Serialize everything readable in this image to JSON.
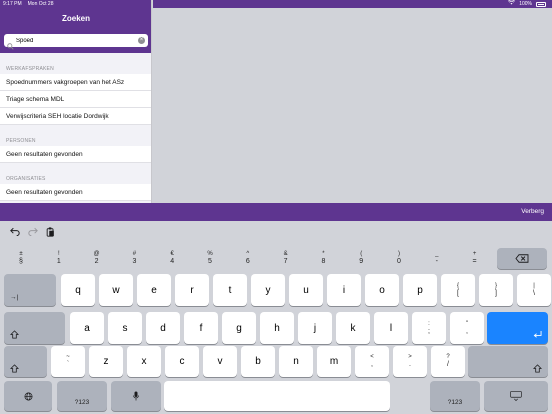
{
  "status": {
    "time": "9:17 PM",
    "date": "Mon Oct 28",
    "battery": "100%"
  },
  "sidebar": {
    "title": "Zoeken",
    "search": {
      "value": "Spoed",
      "placeholder": "Zoeken"
    },
    "sections": [
      {
        "header": "WERKAFSPRAKEN",
        "rows": [
          "Spoednummers vakgroepen van het ASz",
          "Triage schema MDL",
          "Verwijscriteria SEH locatie Dordwijk"
        ]
      },
      {
        "header": "PERSONEN",
        "rows": [
          "Geen resultaten gevonden"
        ]
      },
      {
        "header": "ORGANISATIES",
        "rows": [
          "Geen resultaten gevonden"
        ]
      }
    ]
  },
  "accessory": {
    "hide_label": "Verberg"
  },
  "keyboard": {
    "number_row": [
      {
        "top": "±",
        "bot": "§"
      },
      {
        "top": "!",
        "bot": "1"
      },
      {
        "top": "@",
        "bot": "2"
      },
      {
        "top": "#",
        "bot": "3"
      },
      {
        "top": "€",
        "bot": "4"
      },
      {
        "top": "%",
        "bot": "5"
      },
      {
        "top": "^",
        "bot": "6"
      },
      {
        "top": "&",
        "bot": "7"
      },
      {
        "top": "*",
        "bot": "8"
      },
      {
        "top": "(",
        "bot": "9"
      },
      {
        "top": ")",
        "bot": "0"
      },
      {
        "top": "_",
        "bot": "-"
      },
      {
        "top": "+",
        "bot": "="
      }
    ],
    "row1": [
      "q",
      "w",
      "e",
      "r",
      "t",
      "y",
      "u",
      "i",
      "o",
      "p"
    ],
    "row1_extra": [
      {
        "top": "{",
        "bot": "["
      },
      {
        "top": "}",
        "bot": "]"
      },
      {
        "top": "|",
        "bot": "\\"
      }
    ],
    "row2": [
      "a",
      "s",
      "d",
      "f",
      "g",
      "h",
      "j",
      "k",
      "l"
    ],
    "row2_extra": [
      {
        "top": ":",
        "bot": ";"
      },
      {
        "top": "\"",
        "bot": ","
      }
    ],
    "row3_pre": {
      "top": "~",
      "bot": "`"
    },
    "row3": [
      "z",
      "x",
      "c",
      "v",
      "b",
      "n",
      "m"
    ],
    "row3_extra": [
      {
        "top": "<",
        "bot": ","
      },
      {
        "top": ">",
        "bot": "."
      },
      {
        "top": "?",
        "bot": "/"
      }
    ],
    "mode_label": "?123",
    "return_icon": "return-arrow-icon"
  },
  "colors": {
    "brand": "#5e3590",
    "accent": "#1a84ff"
  }
}
